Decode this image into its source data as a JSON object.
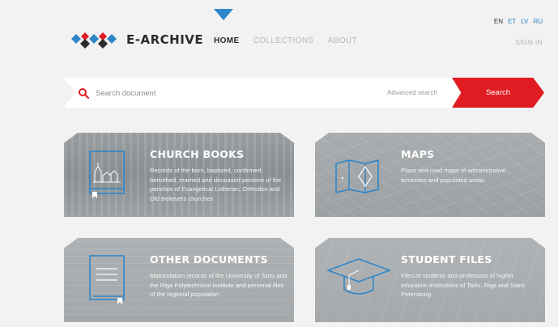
{
  "brand": {
    "name": "E-ARCHIVE",
    "colors": {
      "primary": "#2e86c8",
      "accent": "#e01b22",
      "dark": "#2b2b2b"
    }
  },
  "nav": {
    "items": [
      {
        "label": "HOME",
        "active": true
      },
      {
        "label": "COLLECTIONS",
        "active": false
      },
      {
        "label": "ABOUT",
        "active": false
      }
    ]
  },
  "languages": [
    {
      "code": "EN",
      "current": true
    },
    {
      "code": "ET",
      "current": false
    },
    {
      "code": "LV",
      "current": false
    },
    {
      "code": "RU",
      "current": false
    }
  ],
  "account": {
    "signin_label": "SIGN IN"
  },
  "search": {
    "placeholder": "Search document",
    "advanced_label": "Advanced search",
    "button_label": "Search",
    "icon": "search-icon"
  },
  "collections": [
    {
      "title": "CHURCH BOOKS",
      "description": "Records of the born, baptized, confirmed, betrothed, married and deceased persons of the parishes of Evangelical Lutheran, Orthodox and Old Believers churches",
      "icon": "church-book-icon"
    },
    {
      "title": "MAPS",
      "description": "Plans and road maps of administrative territories and populated areas",
      "icon": "map-icon"
    },
    {
      "title": "OTHER DOCUMENTS",
      "description": "Matriculation records of the University of Tartu and the Riga Polytechnical Institute and personal files of the regional population",
      "icon": "document-book-icon"
    },
    {
      "title": "STUDENT FILES",
      "description": "Files of students and professors of higher education institutions of Tartu, Riga and Saint-Petersburg",
      "icon": "graduation-cap-icon"
    }
  ]
}
